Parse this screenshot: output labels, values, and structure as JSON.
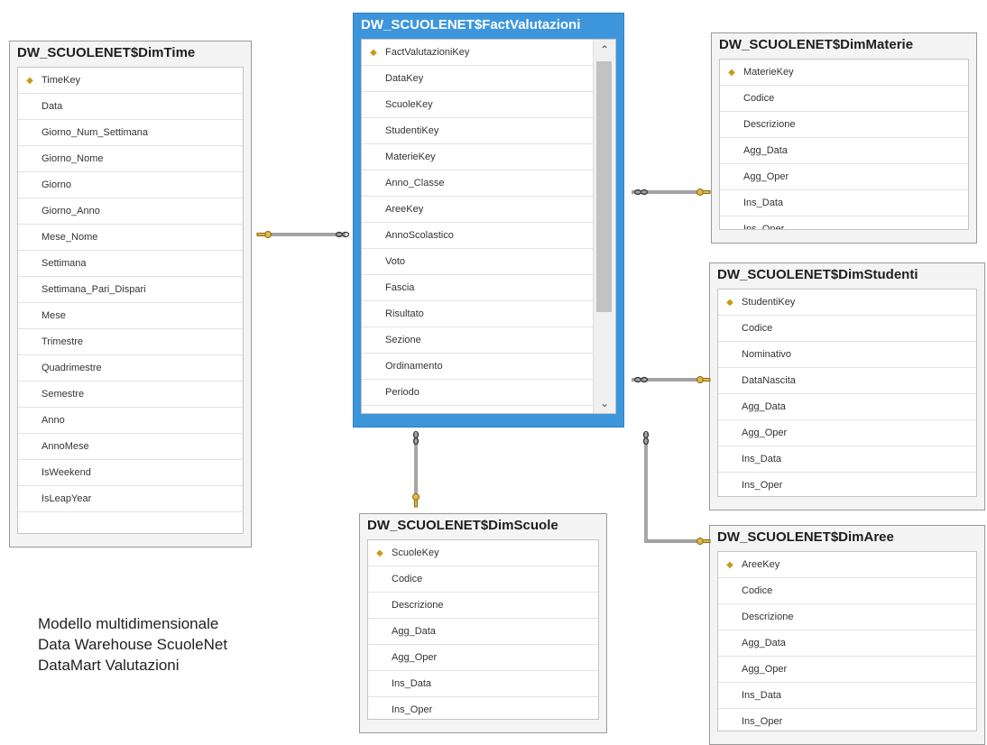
{
  "tables": {
    "time": {
      "title": "DW_SCUOLENET$DimTime",
      "columns": [
        "TimeKey",
        "Data",
        "Giorno_Num_Settimana",
        "Giorno_Nome",
        "Giorno",
        "Giorno_Anno",
        "Mese_Nome",
        "Settimana",
        "Settimana_Pari_Dispari",
        "Mese",
        "Trimestre",
        "Quadrimestre",
        "Semestre",
        "Anno",
        "AnnoMese",
        "IsWeekend",
        "IsLeapYear"
      ],
      "primary_key": "TimeKey"
    },
    "fact": {
      "title": "DW_SCUOLENET$FactValutazioni",
      "columns": [
        "FactValutazioniKey",
        "DataKey",
        "ScuoleKey",
        "StudentiKey",
        "MaterieKey",
        "Anno_Classe",
        "AreeKey",
        "AnnoScolastico",
        "Voto",
        "Fascia",
        "Risultato",
        "Sezione",
        "Ordinamento",
        "Periodo"
      ],
      "primary_key": "FactValutazioniKey"
    },
    "materie": {
      "title": "DW_SCUOLENET$DimMaterie",
      "columns": [
        "MaterieKey",
        "Codice",
        "Descrizione",
        "Agg_Data",
        "Agg_Oper",
        "Ins_Data",
        "Ins_Oper"
      ],
      "primary_key": "MaterieKey"
    },
    "studenti": {
      "title": "DW_SCUOLENET$DimStudenti",
      "columns": [
        "StudentiKey",
        "Codice",
        "Nominativo",
        "DataNascita",
        "Agg_Data",
        "Agg_Oper",
        "Ins_Data",
        "Ins_Oper"
      ],
      "primary_key": "StudentiKey"
    },
    "scuole": {
      "title": "DW_SCUOLENET$DimScuole",
      "columns": [
        "ScuoleKey",
        "Codice",
        "Descrizione",
        "Agg_Data",
        "Agg_Oper",
        "Ins_Data",
        "Ins_Oper"
      ],
      "primary_key": "ScuoleKey"
    },
    "aree": {
      "title": "DW_SCUOLENET$DimAree",
      "columns": [
        "AreeKey",
        "Codice",
        "Descrizione",
        "Agg_Data",
        "Agg_Oper",
        "Ins_Data",
        "Ins_Oper"
      ],
      "primary_key": "AreeKey"
    }
  },
  "icons": {
    "primary_key": "key-icon",
    "relationship_one": "key-icon",
    "relationship_many": "infinity-icon"
  },
  "colors": {
    "selected_table": "#3d96dc",
    "key": "#c89a16"
  },
  "caption": {
    "line1": "Modello multidimensionale",
    "line2": "Data Warehouse ScuoleNet",
    "line3": "DataMart Valutazioni"
  }
}
